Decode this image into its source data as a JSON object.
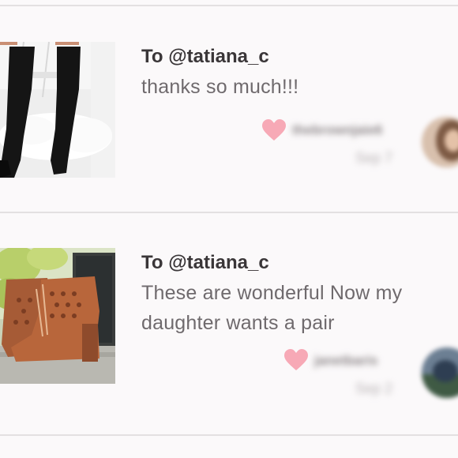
{
  "comments": [
    {
      "title": "To @tatiana_c",
      "message": "thanks so much!!!",
      "username": "thebrownjaie6",
      "date": "Sep 7",
      "thumbnail_icon": "black-thigh-high-boots-photo",
      "like_icon": "heart-icon",
      "like_color": "#f7a9b6"
    },
    {
      "title": "To @tatiana_c",
      "message": "These are wonderful Now my daughter wants a pair",
      "username": "janetbaris",
      "date": "Sep 2",
      "thumbnail_icon": "cognac-lace-up-booties-photo",
      "like_icon": "heart-icon",
      "like_color": "#f7a9b6"
    }
  ]
}
